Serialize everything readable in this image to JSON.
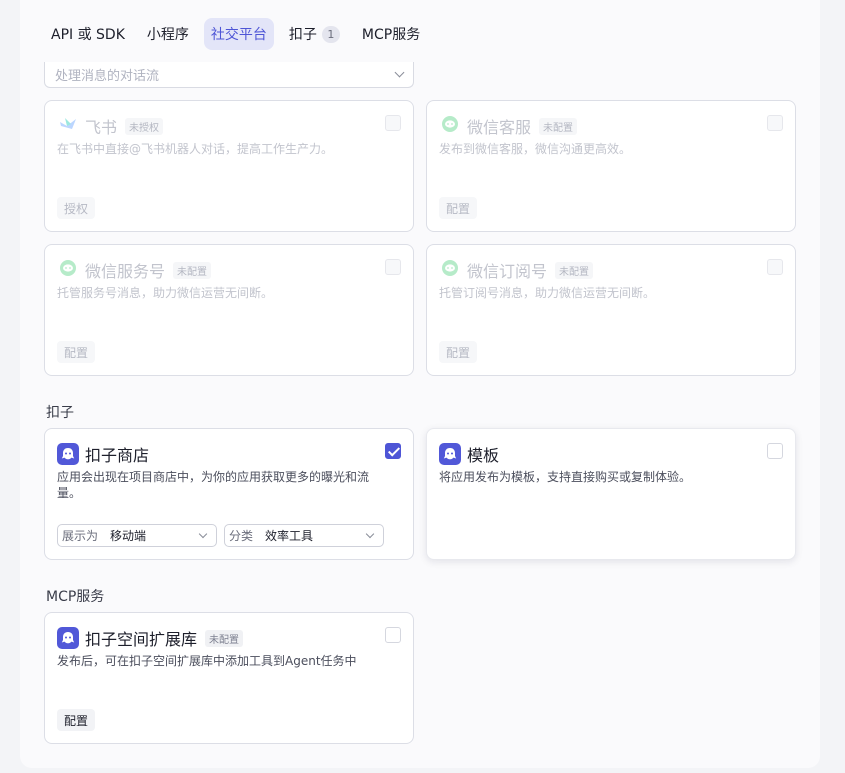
{
  "tabs": [
    {
      "label": "API 或 SDK"
    },
    {
      "label": "小程序"
    },
    {
      "label": "社交平台",
      "active": true
    },
    {
      "label": "扣子",
      "badge": "1"
    },
    {
      "label": "MCP服务"
    }
  ],
  "conversation_select": {
    "value": "处理消息的对话流"
  },
  "social_cards": [
    {
      "title": "飞书",
      "tag": "未授权",
      "desc": "在飞书中直接@飞书机器人对话，提高工作生产力。",
      "button": "授权",
      "icon": "feishu-icon"
    },
    {
      "title": "微信客服",
      "tag": "未配置",
      "desc": "发布到微信客服，微信沟通更高效。",
      "button": "配置",
      "icon": "wechat-icon"
    },
    {
      "title": "微信服务号",
      "tag": "未配置",
      "desc": "托管服务号消息，助力微信运营无间断。",
      "button": "配置",
      "icon": "wechat-icon"
    },
    {
      "title": "微信订阅号",
      "tag": "未配置",
      "desc": "托管订阅号消息，助力微信运营无间断。",
      "button": "配置",
      "icon": "wechat-icon"
    }
  ],
  "koz_section": {
    "label": "扣子",
    "store_card": {
      "title": "扣子商店",
      "desc": "应用会出现在项目商店中，为你的应用获取更多的曝光和流量。",
      "checked": true,
      "display_label": "展示为",
      "display_value": "移动端",
      "category_label": "分类",
      "category_value": "效率工具"
    },
    "template_card": {
      "title": "模板",
      "desc": "将应用发布为模板，支持直接购买或复制体验。",
      "checked": false
    }
  },
  "mcp_section": {
    "label": "MCP服务",
    "card": {
      "title": "扣子空间扩展库",
      "tag": "未配置",
      "desc": "发布后，可在扣子空间扩展库中添加工具到Agent任务中",
      "button": "配置"
    }
  },
  "colors": {
    "accent": "#4e55d6",
    "wechat": "#34c76b",
    "feishu": "#3b6cf6"
  }
}
